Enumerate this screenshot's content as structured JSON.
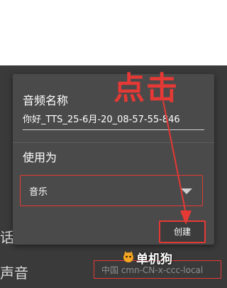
{
  "background": {
    "row_label_1": "话",
    "row_label_2": "声音",
    "locale_value": "中国 cmn-CN-x-ccc-local"
  },
  "dialog": {
    "title": "音频名称",
    "name_value": "你好_TTS_25-6月-20_08-57-55-846",
    "use_as_label": "使用为",
    "use_as_value": "音乐",
    "create_button": "创建"
  },
  "annotation": {
    "text": "点击",
    "color": "#e53935"
  },
  "watermark": {
    "text": "单机狗"
  }
}
